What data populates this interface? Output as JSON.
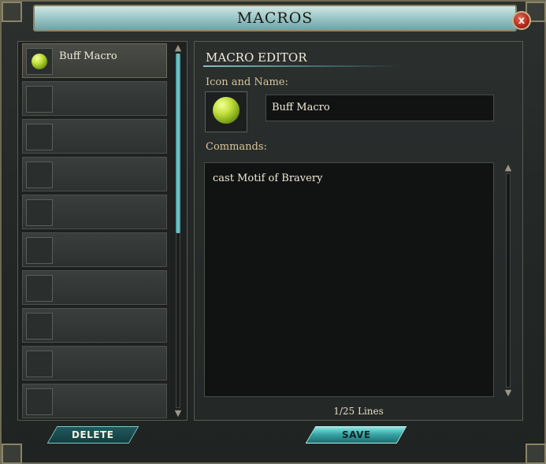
{
  "window": {
    "title": "MACROS",
    "close_label": "x"
  },
  "macro_list": {
    "items": [
      {
        "label": "Buff Macro",
        "has_icon": true,
        "selected": true
      },
      {
        "label": "",
        "has_icon": false,
        "selected": false
      },
      {
        "label": "",
        "has_icon": false,
        "selected": false
      },
      {
        "label": "",
        "has_icon": false,
        "selected": false
      },
      {
        "label": "",
        "has_icon": false,
        "selected": false
      },
      {
        "label": "",
        "has_icon": false,
        "selected": false
      },
      {
        "label": "",
        "has_icon": false,
        "selected": false
      },
      {
        "label": "",
        "has_icon": false,
        "selected": false
      },
      {
        "label": "",
        "has_icon": false,
        "selected": false
      },
      {
        "label": "",
        "has_icon": false,
        "selected": false
      }
    ],
    "delete_label": "DELETE"
  },
  "editor": {
    "section_title": "MACRO EDITOR",
    "icon_name_label": "Icon and Name:",
    "name_value": "Buff Macro",
    "commands_label": "Commands:",
    "commands_value": "cast Motif of Bravery",
    "lines_count": "1/25 Lines",
    "save_label": "SAVE"
  },
  "icons": {
    "macro_icon": "green-apple-icon",
    "close": "close-icon",
    "scroll_up": "chevron-up-icon",
    "scroll_down": "chevron-down-icon"
  },
  "colors": {
    "accent": "#7fc9c9",
    "title_text": "#1a1a14",
    "label_gold": "#d6c69a"
  }
}
